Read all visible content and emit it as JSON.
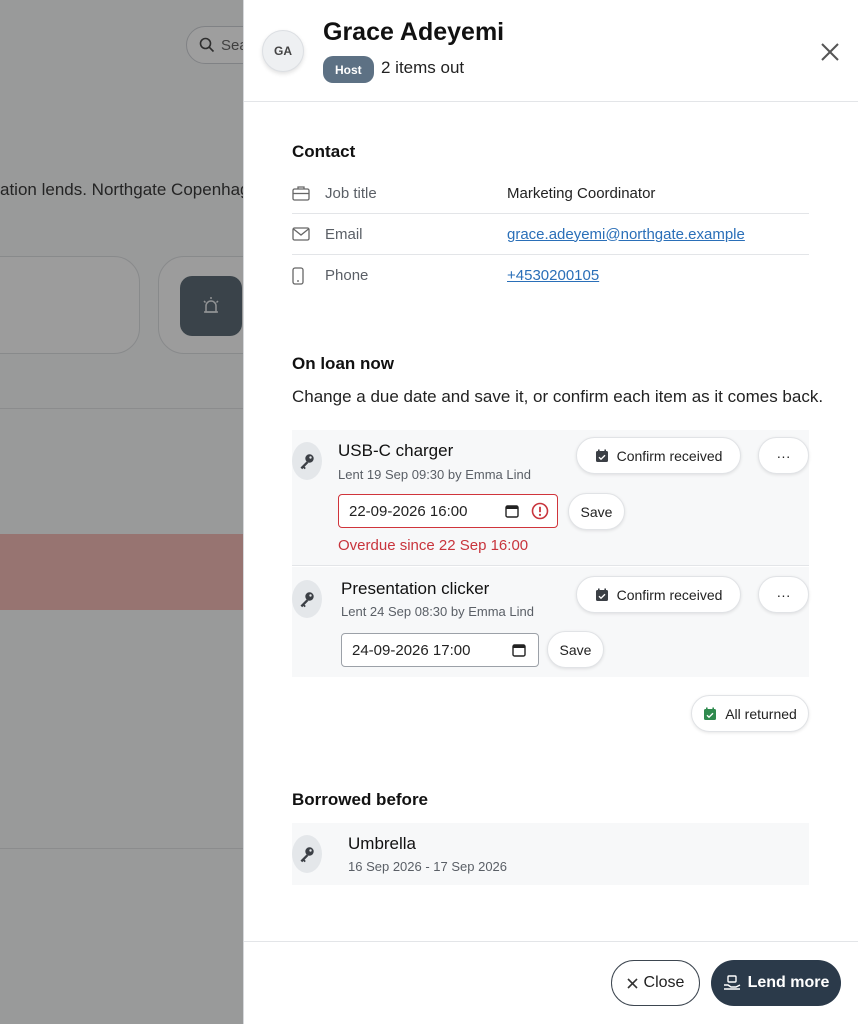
{
  "background": {
    "search_placeholder": "Sea",
    "intro_text": "ation lends. Northgate Copenhag"
  },
  "header": {
    "avatar_initials": "GA",
    "name": "Grace Adeyemi",
    "role_badge": "Host",
    "items_out": "2 items out"
  },
  "contact": {
    "title": "Contact",
    "rows": [
      {
        "label": "Job title",
        "value": "Marketing Coordinator",
        "icon": "briefcase-icon"
      },
      {
        "label": "Email",
        "value": "grace.adeyemi@northgate.example",
        "icon": "mail-icon"
      },
      {
        "label": "Phone",
        "value": "+4530200105",
        "icon": "phone-icon"
      }
    ]
  },
  "on_loan": {
    "title": "On loan now",
    "description": "Change a due date and save it, or confirm each item as it comes back.",
    "confirm_label": "Confirm received",
    "more_label": "···",
    "save_label": "Save",
    "items": [
      {
        "name": "USB-C charger",
        "meta": "Lent 19 Sep 09:30 by Emma Lind",
        "due": "22-09-2026 16:00",
        "overdue_text": "Overdue since 22 Sep 16:00"
      },
      {
        "name": "Presentation clicker",
        "meta": "Lent 24 Sep 08:30 by Emma Lind",
        "due": "24-09-2026 17:00"
      }
    ],
    "all_returned_label": "All returned"
  },
  "history": {
    "title": "Borrowed before",
    "items": [
      {
        "name": "Umbrella",
        "dates": "16 Sep 2026 - 17 Sep 2026"
      }
    ]
  },
  "footer": {
    "close_label": "Close",
    "lend_more_label": "Lend more"
  },
  "colors": {
    "primary": "#2b3a4a",
    "badge": "#5d7184",
    "error": "#c8343c",
    "link": "#2a6fb8"
  }
}
